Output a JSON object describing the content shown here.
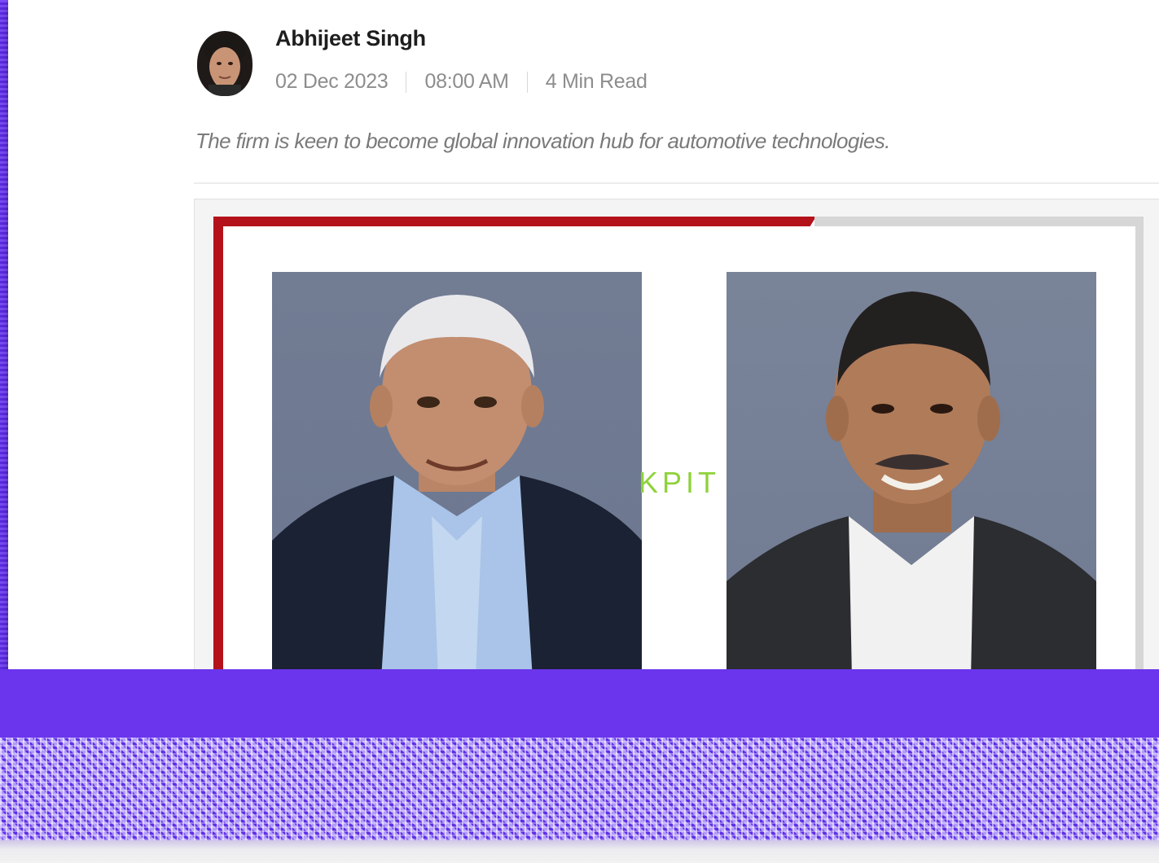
{
  "article": {
    "author_name": "Abhijeet Singh",
    "date": "02 Dec 2023",
    "time": "08:00 AM",
    "read_time": "4 Min Read",
    "summary": "The firm is keen to become global innovation hub for automotive technologies."
  },
  "hero_image": {
    "brand_text": "KPIT"
  },
  "colors": {
    "background_purple": "#6a3af0",
    "accent_red": "#b3121b",
    "brand_green": "#8fd23a"
  }
}
